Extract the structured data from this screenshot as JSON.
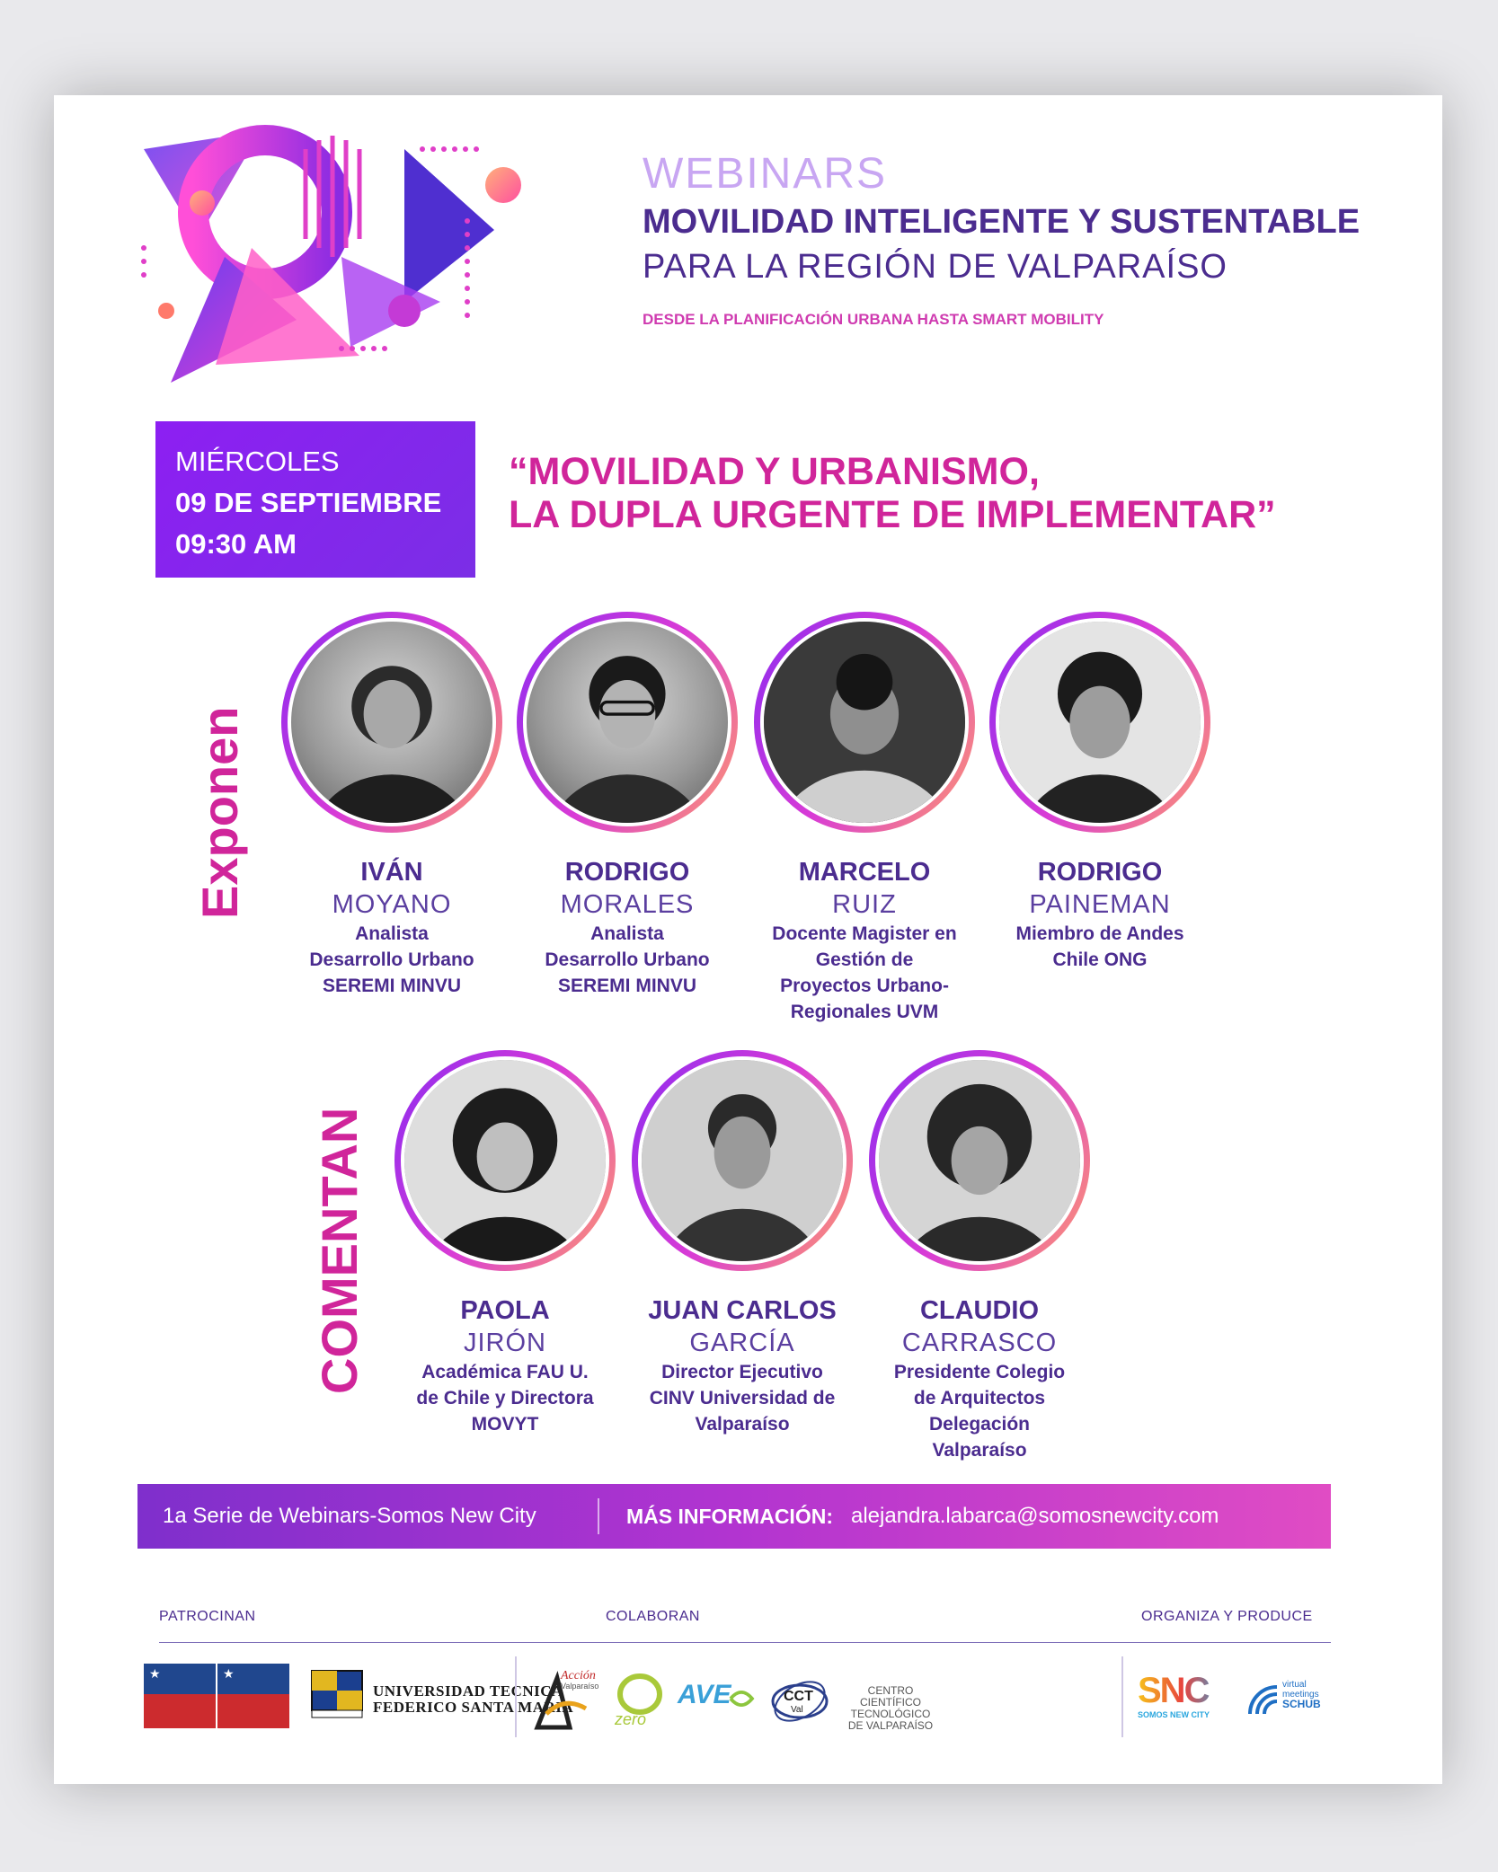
{
  "header": {
    "webinars": "WEBINARS",
    "title_line1": "MOVILIDAD INTELIGENTE Y SUSTENTABLE",
    "title_line2": "PARA LA REGIÓN DE VALPARAÍSO",
    "subtitle": "DESDE LA PLANIFICACIÓN URBANA HASTA SMART MOBILITY"
  },
  "event": {
    "day": "MIÉRCOLES",
    "date": "09 DE SEPTIEMBRE",
    "time": "09:30 AM",
    "title_line1": "“MOVILIDAD Y URBANISMO,",
    "title_line2": "LA DUPLA URGENTE DE IMPLEMENTAR”"
  },
  "sections": {
    "exponen": "Exponen",
    "comentan": "COMENTAN"
  },
  "exponen": [
    {
      "first": "IVÁN",
      "last": "MOYANO",
      "role": [
        "Analista",
        "Desarrollo Urbano",
        "SEREMI MINVU"
      ]
    },
    {
      "first": "RODRIGO",
      "last": "MORALES",
      "role": [
        "Analista",
        "Desarrollo Urbano",
        "SEREMI MINVU"
      ]
    },
    {
      "first": "MARCELO",
      "last": "RUIZ",
      "role": [
        "Docente Magister en",
        "Gestión de",
        "Proyectos Urbano-",
        "Regionales UVM"
      ]
    },
    {
      "first": "RODRIGO",
      "last": "PAINEMAN",
      "role": [
        "Miembro de Andes",
        "Chile ONG"
      ]
    }
  ],
  "comentan": [
    {
      "first": "PAOLA",
      "last": "JIRÓN",
      "role": [
        "Académica FAU U.",
        "de Chile y Directora",
        "MOVYT"
      ]
    },
    {
      "first": "JUAN CARLOS",
      "last": "GARCÍA",
      "role": [
        "Director Ejecutivo",
        "CINV Universidad de",
        "Valparaíso"
      ]
    },
    {
      "first": "CLAUDIO",
      "last": "CARRASCO",
      "role": [
        "Presidente Colegio",
        "de Arquitectos",
        "Delegación",
        "Valparaíso"
      ]
    }
  ],
  "info_bar": {
    "series": "1a Serie de Webinars-Somos New City",
    "more_label": "MÁS INFORMACIÓN:",
    "email": "alejandra.labarca@somosnewcity.com"
  },
  "sponsors": {
    "patrocinan": "PATROCINAN",
    "colaboran": "COLABORAN",
    "organiza": "ORGANIZA Y PRODUCE",
    "usm_line1": "UNIVERSIDAD TECNICA",
    "usm_line2": "FEDERICO SANTA MARIA",
    "accion_top": "Acción",
    "accion_sub": "Valparaíso",
    "zero": "zero",
    "ave": "AVE",
    "cct": "CCT",
    "cct_sub": "Val",
    "cct_text1": "CENTRO CIENTÍFICO",
    "cct_text2": "TECNOLÓGICO",
    "cct_text3": "DE VALPARAÍSO",
    "snc": "SNC",
    "snc_sub": "SOMOS NEW CITY",
    "schub_line1": "virtual",
    "schub_line2": "meetings",
    "schub_line3": "SCHUB"
  },
  "colors": {
    "purple_dark": "#4b2c8f",
    "magenta": "#d0259a",
    "violet": "#8d1ff2"
  }
}
